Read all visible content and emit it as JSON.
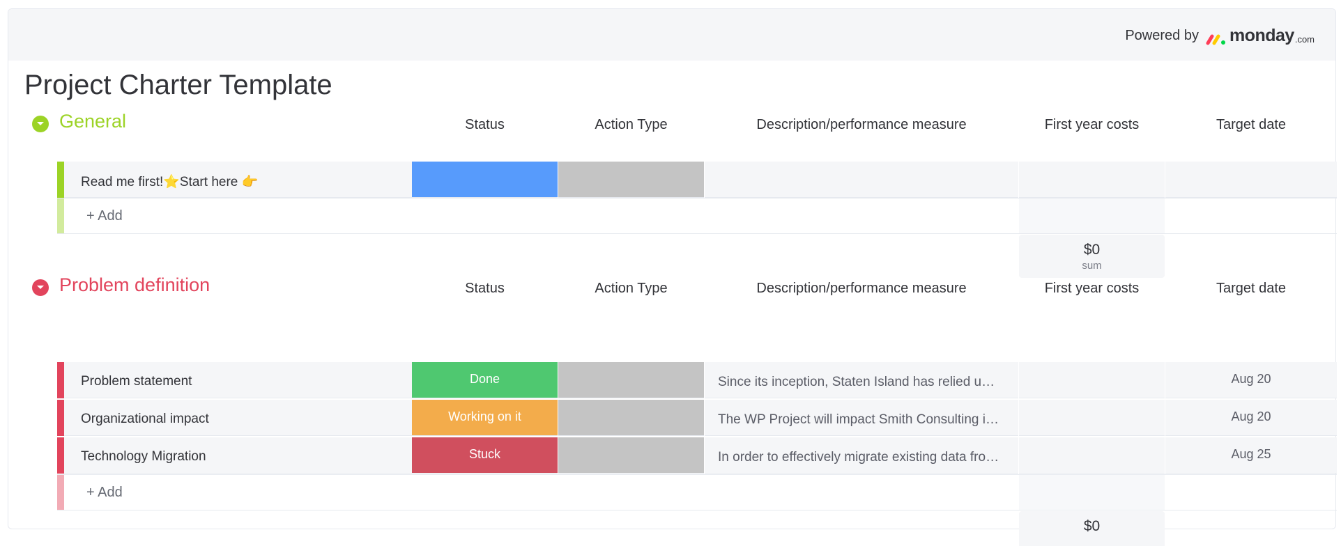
{
  "header": {
    "powered_by": "Powered by",
    "brand": "monday",
    "brand_tld": ".com"
  },
  "page": {
    "title": "Project Charter Template"
  },
  "columns": [
    "Status",
    "Action Type",
    "Description/performance measure",
    "First year costs",
    "Target date"
  ],
  "groups": [
    {
      "name": "General",
      "color": "#9cd326",
      "rows": [
        {
          "name": "Read me first!⭐Start here 👉",
          "status": "",
          "status_color": "#579bfc",
          "description": "",
          "date": ""
        }
      ],
      "add_label": "+ Add",
      "sum_value": "$0",
      "sum_label": "sum"
    },
    {
      "name": "Problem definition",
      "color": "#e2445c",
      "rows": [
        {
          "name": "Problem statement",
          "status": "Done",
          "status_color": "#00c875",
          "description": "Since its inception, Staten Island has relied u…",
          "date": "Aug 20"
        },
        {
          "name": "Organizational impact",
          "status": "Working on it",
          "status_color": "#fdab3d",
          "description": "The WP Project will impact Smith Consulting i…",
          "date": "Aug 20"
        },
        {
          "name": "Technology Migration",
          "status": "Stuck",
          "status_color": "#e2445c",
          "description": "In order to effectively migrate existing data fro…",
          "date": "Aug 25"
        }
      ],
      "add_label": "+ Add",
      "sum_value": "$0"
    }
  ]
}
